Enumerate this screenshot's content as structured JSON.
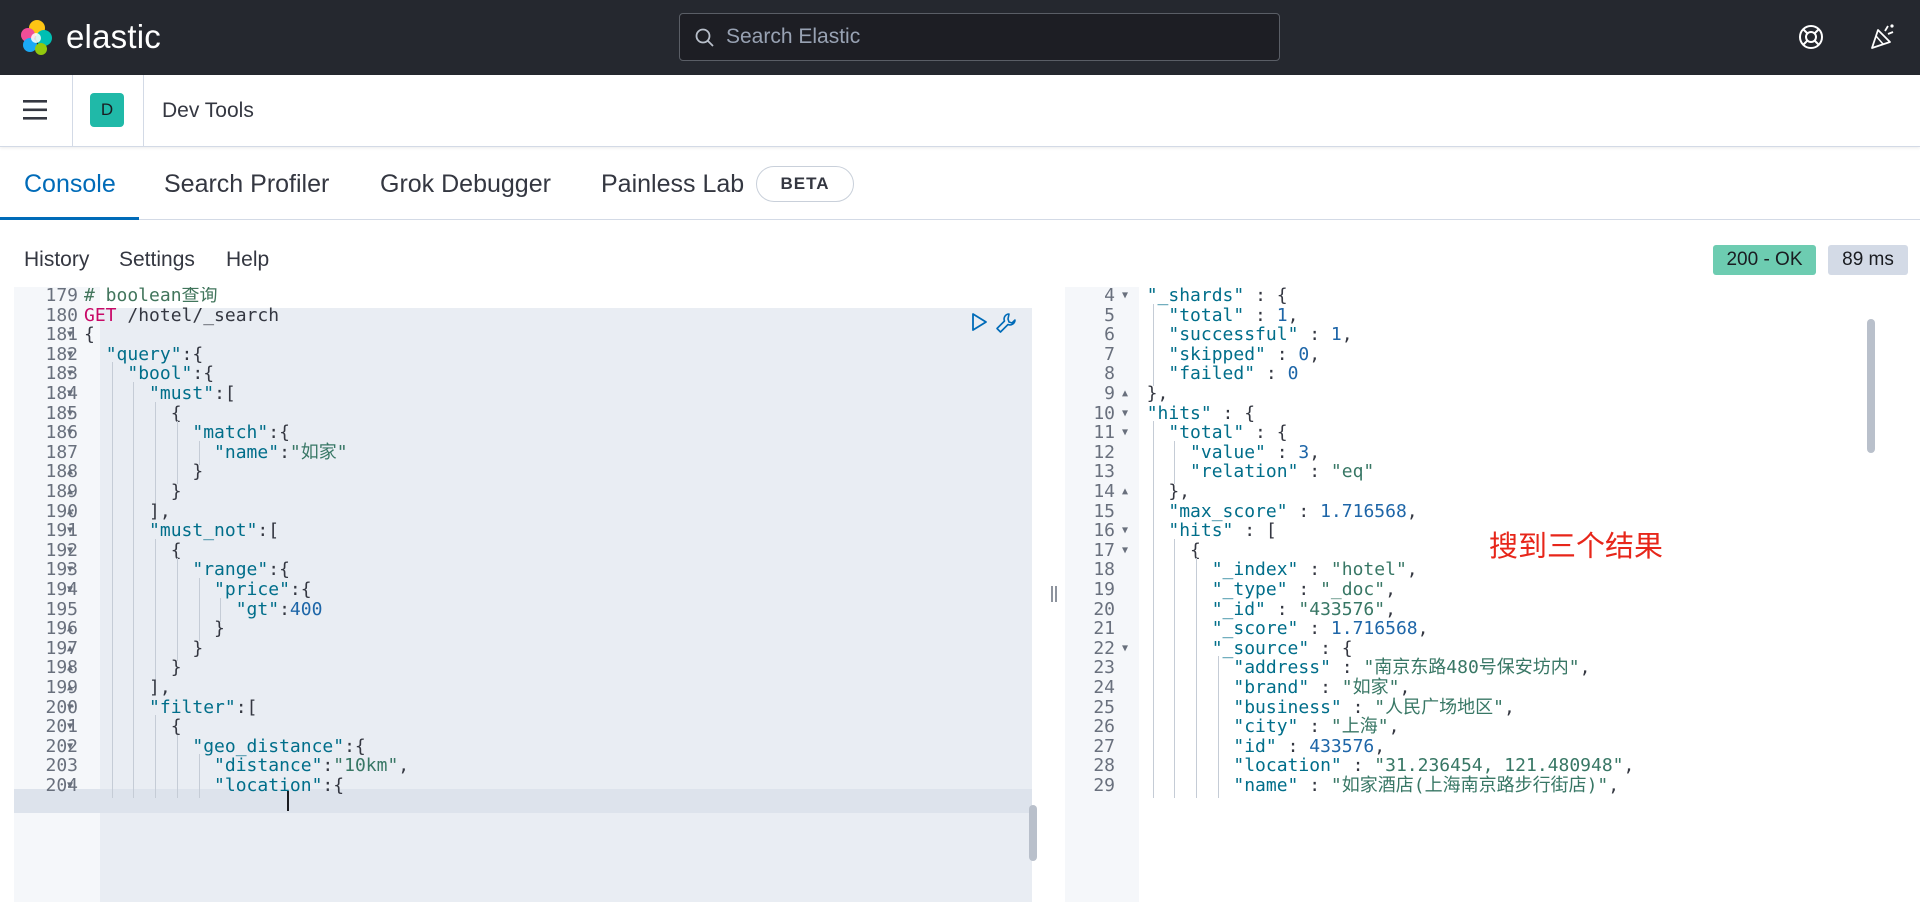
{
  "header": {
    "logo_text": "elastic",
    "search_placeholder": "Search Elastic"
  },
  "breadcrumb": {
    "space_initial": "D",
    "title": "Dev Tools"
  },
  "tabs": [
    {
      "label": "Console",
      "active": true
    },
    {
      "label": "Search Profiler",
      "active": false
    },
    {
      "label": "Grok Debugger",
      "active": false
    },
    {
      "label": "Painless Lab",
      "active": false
    }
  ],
  "beta_label": "BETA",
  "console_menu": {
    "history": "History",
    "settings": "Settings",
    "help": "Help"
  },
  "response_status": {
    "status": "200 - OK",
    "time": "89 ms",
    "status_color": "#6dccb1"
  },
  "request_lines": [
    {
      "num": "179",
      "fold": "",
      "text": "# boolean查询"
    },
    {
      "num": "180",
      "fold": "",
      "text": "GET /hotel/_search"
    },
    {
      "num": "181",
      "fold": "open",
      "text": "{"
    },
    {
      "num": "182",
      "fold": "open",
      "text": "  \"query\":{"
    },
    {
      "num": "183",
      "fold": "open",
      "text": "    \"bool\":{"
    },
    {
      "num": "184",
      "fold": "open",
      "text": "      \"must\":["
    },
    {
      "num": "185",
      "fold": "open",
      "text": "        {"
    },
    {
      "num": "186",
      "fold": "open",
      "text": "          \"match\":{"
    },
    {
      "num": "187",
      "fold": "",
      "text": "            \"name\":\"如家\""
    },
    {
      "num": "188",
      "fold": "close",
      "text": "          }"
    },
    {
      "num": "189",
      "fold": "close",
      "text": "        }"
    },
    {
      "num": "190",
      "fold": "close",
      "text": "      ],"
    },
    {
      "num": "191",
      "fold": "open",
      "text": "      \"must_not\":["
    },
    {
      "num": "192",
      "fold": "open",
      "text": "        {"
    },
    {
      "num": "193",
      "fold": "open",
      "text": "          \"range\":{"
    },
    {
      "num": "194",
      "fold": "open",
      "text": "            \"price\":{"
    },
    {
      "num": "195",
      "fold": "",
      "text": "              \"gt\":400"
    },
    {
      "num": "196",
      "fold": "close",
      "text": "            }"
    },
    {
      "num": "197",
      "fold": "close",
      "text": "          }"
    },
    {
      "num": "198",
      "fold": "close",
      "text": "        }"
    },
    {
      "num": "199",
      "fold": "close",
      "text": "      ],"
    },
    {
      "num": "200",
      "fold": "open",
      "text": "      \"filter\":["
    },
    {
      "num": "201",
      "fold": "open",
      "text": "        {"
    },
    {
      "num": "202",
      "fold": "open",
      "text": "          \"geo_distance\":{"
    },
    {
      "num": "203",
      "fold": "",
      "text": "            \"distance\":\"10km\","
    },
    {
      "num": "204",
      "fold": "open",
      "text": "            \"location\":{"
    }
  ],
  "response_lines": [
    {
      "num": "4",
      "fold": "open",
      "text": "  \"_shards\" : {"
    },
    {
      "num": "5",
      "fold": "",
      "text": "    \"total\" : 1,"
    },
    {
      "num": "6",
      "fold": "",
      "text": "    \"successful\" : 1,"
    },
    {
      "num": "7",
      "fold": "",
      "text": "    \"skipped\" : 0,"
    },
    {
      "num": "8",
      "fold": "",
      "text": "    \"failed\" : 0"
    },
    {
      "num": "9",
      "fold": "close",
      "text": "  },"
    },
    {
      "num": "10",
      "fold": "open",
      "text": "  \"hits\" : {"
    },
    {
      "num": "11",
      "fold": "open",
      "text": "    \"total\" : {"
    },
    {
      "num": "12",
      "fold": "",
      "text": "      \"value\" : 3,"
    },
    {
      "num": "13",
      "fold": "",
      "text": "      \"relation\" : \"eq\""
    },
    {
      "num": "14",
      "fold": "close",
      "text": "    },"
    },
    {
      "num": "15",
      "fold": "",
      "text": "    \"max_score\" : 1.716568,"
    },
    {
      "num": "16",
      "fold": "open",
      "text": "    \"hits\" : ["
    },
    {
      "num": "17",
      "fold": "open",
      "text": "      {"
    },
    {
      "num": "18",
      "fold": "",
      "text": "        \"_index\" : \"hotel\","
    },
    {
      "num": "19",
      "fold": "",
      "text": "        \"_type\" : \"_doc\","
    },
    {
      "num": "20",
      "fold": "",
      "text": "        \"_id\" : \"433576\","
    },
    {
      "num": "21",
      "fold": "",
      "text": "        \"_score\" : 1.716568,"
    },
    {
      "num": "22",
      "fold": "open",
      "text": "        \"_source\" : {"
    },
    {
      "num": "23",
      "fold": "",
      "text": "          \"address\" : \"南京东路480号保安坊内\","
    },
    {
      "num": "24",
      "fold": "",
      "text": "          \"brand\" : \"如家\","
    },
    {
      "num": "25",
      "fold": "",
      "text": "          \"business\" : \"人民广场地区\","
    },
    {
      "num": "26",
      "fold": "",
      "text": "          \"city\" : \"上海\","
    },
    {
      "num": "27",
      "fold": "",
      "text": "          \"id\" : 433576,"
    },
    {
      "num": "28",
      "fold": "",
      "text": "          \"location\" : \"31.236454, 121.480948\","
    },
    {
      "num": "29",
      "fold": "",
      "text": "          \"name\" : \"如家酒店(上海南京路步行街店)\","
    }
  ],
  "annotation": "搜到三个结果",
  "icons": {
    "logo": "elastic-logo-icon",
    "search": "search-icon",
    "help": "help-lifebuoy-icon",
    "news": "newsfeed-icon",
    "menu": "hamburger-menu-icon",
    "run": "play-icon",
    "tools": "wrench-icon"
  }
}
